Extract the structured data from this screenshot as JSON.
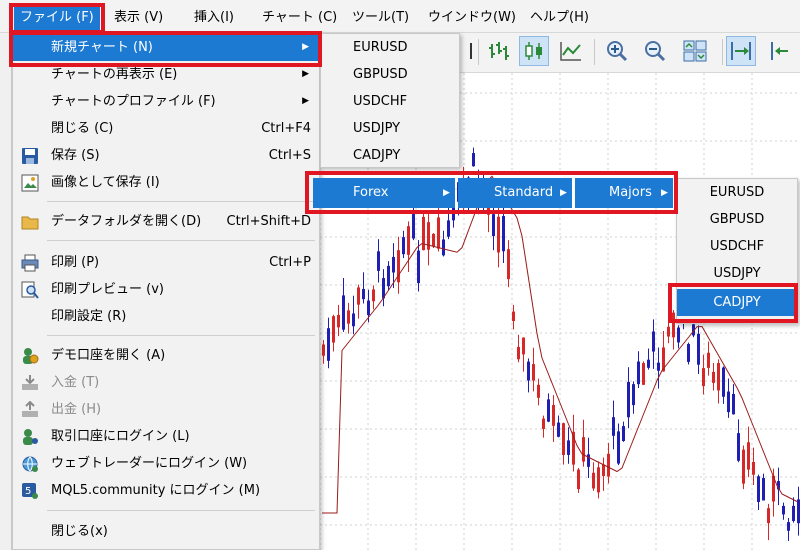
{
  "menubar": {
    "items": [
      {
        "label": "ファイル (F)",
        "active": true
      },
      {
        "label": "表示 (V)"
      },
      {
        "label": "挿入(I)"
      },
      {
        "label": "チャート (C)"
      },
      {
        "label": "ツール(T)"
      },
      {
        "label": "ウインドウ(W)"
      },
      {
        "label": "ヘルプ(H)"
      }
    ]
  },
  "file_menu": {
    "items": [
      {
        "label": "新規チャート (N)",
        "submenu": true,
        "highlighted": true
      },
      {
        "label": "チャートの再表示 (E)",
        "submenu": true
      },
      {
        "label": "チャートのプロファイル (F)",
        "submenu": true
      },
      {
        "label": "閉じる (C)",
        "shortcut": "Ctrl+F4"
      },
      {
        "label": "保存 (S)",
        "shortcut": "Ctrl+S",
        "icon": "save-icon"
      },
      {
        "label": "画像として保存 (I)",
        "icon": "image-save-icon"
      },
      {
        "label": "データフォルダを開く(D)",
        "shortcut": "Ctrl+Shift+D",
        "icon": "folder-icon"
      },
      {
        "label": "印刷 (P)",
        "shortcut": "Ctrl+P",
        "icon": "print-icon"
      },
      {
        "label": "印刷プレビュー (v)",
        "icon": "print-preview-icon"
      },
      {
        "label": "印刷設定 (R)"
      },
      {
        "label": "デモ口座を開く (A)",
        "icon": "demo-account-icon"
      },
      {
        "label": "入金 (T)",
        "disabled": true,
        "icon": "deposit-icon"
      },
      {
        "label": "出金 (H)",
        "disabled": true,
        "icon": "withdraw-icon"
      },
      {
        "label": "取引口座にログイン (L)",
        "icon": "login-icon"
      },
      {
        "label": "ウェブトレーダーにログイン (W)",
        "icon": "webtrader-icon"
      },
      {
        "label": "MQL5.community にログイン (M)",
        "icon": "mql5-icon"
      },
      {
        "label": "閉じる(x)"
      }
    ]
  },
  "symbol_menu": {
    "items": [
      "EURUSD",
      "GBPUSD",
      "USDCHF",
      "USDJPY",
      "CADJPY"
    ]
  },
  "submenu_chain": {
    "forex": "Forex",
    "standard": "Standard",
    "majors": "Majors"
  },
  "majors_menu": {
    "items": [
      "EURUSD",
      "GBPUSD",
      "USDCHF",
      "USDJPY",
      "CADJPY"
    ],
    "selected": "CADJPY"
  },
  "colors": {
    "highlight": "#1c7ad3",
    "annotation_red": "#e01622",
    "bull_candle": "#d62828",
    "bear_candle": "#1f1fb4",
    "moving_average": "#9b1b1b"
  },
  "toolbar": {
    "icons": [
      "line-chart-icon",
      "bar-chart-icon",
      "candlestick-icon",
      "line-graph-icon",
      "zoom-in-icon",
      "zoom-out-icon",
      "tile-windows-icon",
      "autoscroll-icon",
      "chart-shift-icon"
    ]
  }
}
